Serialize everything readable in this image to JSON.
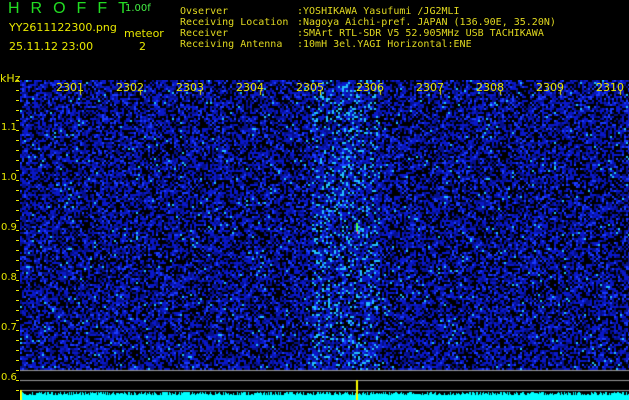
{
  "header": {
    "program": "HROFFT",
    "version": "1.00f",
    "filename": "YY2611122300.png",
    "datetime": "25.11.12 23:00",
    "meteor_label": "meteor",
    "meteor_count": "2"
  },
  "info": [
    {
      "key": "Ovserver",
      "value": ":YOSHIKAWA Yasufumi /JG2MLI"
    },
    {
      "key": "Receiving Location",
      "value": ":Nagoya Aichi-pref. JAPAN (136.90E, 35.20N)"
    },
    {
      "key": "Receiver",
      "value": ":SMArt RTL-SDR V5 52.905MHz USB TACHIKAWA"
    },
    {
      "key": "Receiving Antenna",
      "value": ":10mH 3el.YAGI Horizontal:ENE"
    }
  ],
  "axis": {
    "unit": "kHz",
    "time_labels": [
      "2301",
      "2302",
      "2303",
      "2304",
      "2305",
      "2306",
      "2307",
      "2308",
      "2309",
      "2310"
    ],
    "freq_labels": [
      "1.1",
      "1.0",
      "0.9",
      "0.8",
      "0.7",
      "0.6"
    ]
  },
  "colors": {
    "text": "#e8e800",
    "title": "#22dd22",
    "spectrum": "#00ffff",
    "noise": "#0a1ad0",
    "meteor": "#44ff44"
  }
}
